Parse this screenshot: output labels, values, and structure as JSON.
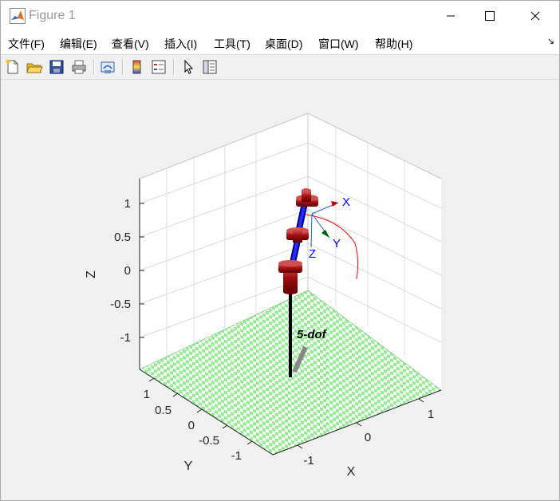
{
  "window": {
    "title": "Figure 1"
  },
  "menu": [
    {
      "label": "文件(F)"
    },
    {
      "label": "编辑(E)"
    },
    {
      "label": "查看(V)"
    },
    {
      "label": "插入(I)"
    },
    {
      "label": "工具(T)"
    },
    {
      "label": "桌面(D)"
    },
    {
      "label": "窗口(W)"
    },
    {
      "label": "帮助(H)"
    }
  ],
  "toolbar": [
    "new-figure-icon",
    "open-file-icon",
    "save-icon",
    "print-icon",
    "link-plot-icon",
    "colorbar-icon",
    "legend-icon",
    "select-pointer-icon",
    "property-inspector-icon"
  ],
  "plot": {
    "z_axis": {
      "label": "Z",
      "ticks": [
        "1",
        "0.5",
        "0",
        "-0.5",
        "-1"
      ]
    },
    "y_axis": {
      "label": "Y",
      "ticks": [
        "1",
        "0.5",
        "0",
        "-0.5",
        "-1"
      ]
    },
    "x_axis": {
      "label": "X",
      "ticks": [
        "1",
        "0",
        "-1"
      ]
    },
    "robot_name": "5-dof",
    "frame_labels": {
      "x": "X",
      "y": "Y",
      "z": "Z"
    },
    "colors": {
      "floor_light": "#90ee90",
      "floor_white": "#ffffff",
      "link": "#0000dd",
      "joint": "#b01818",
      "frame_label": "#0000ff",
      "trail": "#ff0000"
    }
  }
}
